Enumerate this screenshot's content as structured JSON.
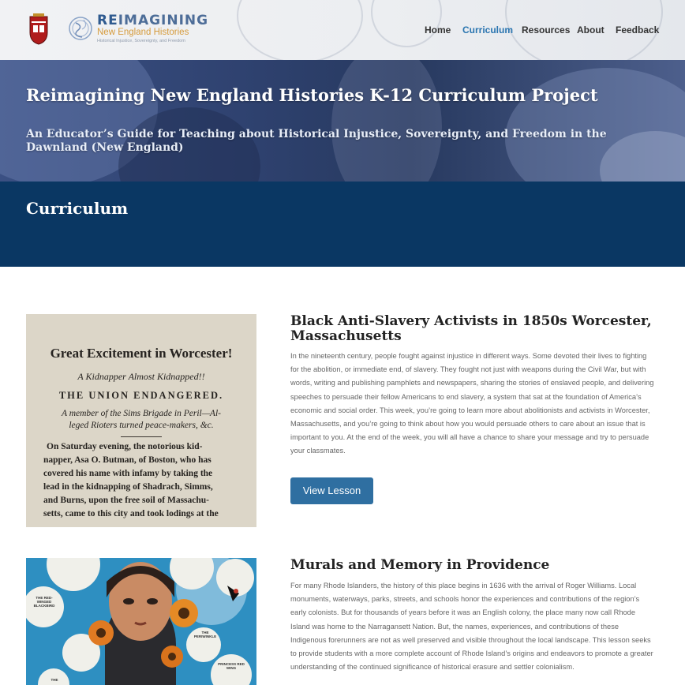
{
  "header": {
    "logo": {
      "title_prefix": "RE",
      "title_rest": "IMAGINING",
      "subtitle": "New England Histories",
      "tagline": "Historical Injustice, Sovereignty, and Freedom"
    },
    "nav": [
      {
        "label": "Home",
        "active": false
      },
      {
        "label": "Curriculum",
        "active": true
      },
      {
        "label": "Resources",
        "active": false
      },
      {
        "label": "About",
        "active": false
      },
      {
        "label": "Feedback",
        "active": false
      }
    ]
  },
  "hero": {
    "title": "Reimagining New England Histories K-12 Curriculum Project",
    "subtitle": "An Educator’s Guide for Teaching about Historical Injustice, Sovereignty, and Freedom in the Dawnland (New England)"
  },
  "section": {
    "title": "Curriculum"
  },
  "lessons": [
    {
      "title": "Black Anti-Slavery Activists in 1850s Worcester, Massachusetts",
      "body": "In the nineteenth century, people fought against injustice in different ways. Some devoted their lives to fighting for the abolition, or immediate end, of slavery. They fought not just with weapons during the Civil War, but with words, writing and publishing pamphlets and newspapers, sharing the stories of enslaved people, and delivering speeches to persuade their fellow Americans to end slavery, a system that sat at the foundation of America’s economic and social order. This week, you’re going to learn more about abolitionists and activists in Worcester, Massachusetts, and you’re going to think about how you would persuade others to care about an issue that is important to you. At the end of the week, you will all have a chance to share your message and try to persuade your classmates.",
      "button": "View Lesson",
      "image": {
        "headline": "Great Excitement in Worcester!",
        "line1": "A Kidnapper Almost Kidnapped!!",
        "line2": "THE UNION ENDANGERED.",
        "line3": "A member of the Sims Brigade in Peril—Al-",
        "line4": "leged Rioters turned peace-makers, &c.",
        "body": [
          "On Saturday evening, the notorious kid-",
          "napper, Asa O. Butman, of Boston, who has",
          "covered his name with infamy by taking the",
          "lead in the kidnapping of Shadrach, Simms,",
          "and Burns, upon the free soil of Massachu-",
          "setts, came to this city and took lodings at the"
        ]
      }
    },
    {
      "title": "Murals and Memory in Providence",
      "body": "For many Rhode Islanders, the history of this place begins in 1636 with the arrival of Roger Williams. Local monuments, waterways, parks, streets, and schools honor the experiences and contributions of the region’s early colonists. But for thousands of years before it was an English colony, the place many now call Rhode Island was home to the Narragansett Nation. But, the names, experiences, and contributions of these Indigenous forerunners are not as well preserved and visible throughout the local landscape. This lesson seeks to provide students with a more complete account of Rhode Island’s origins and endeavors to promote a greater understanding of the continued significance of historical erasure and settler colonialism.",
      "image": {
        "bubbles": [
          "THE RED-WINGED BLACKBIRD",
          "THE PERIWINKLE",
          "PRINCESS RED WING",
          "THE"
        ]
      }
    }
  ]
}
